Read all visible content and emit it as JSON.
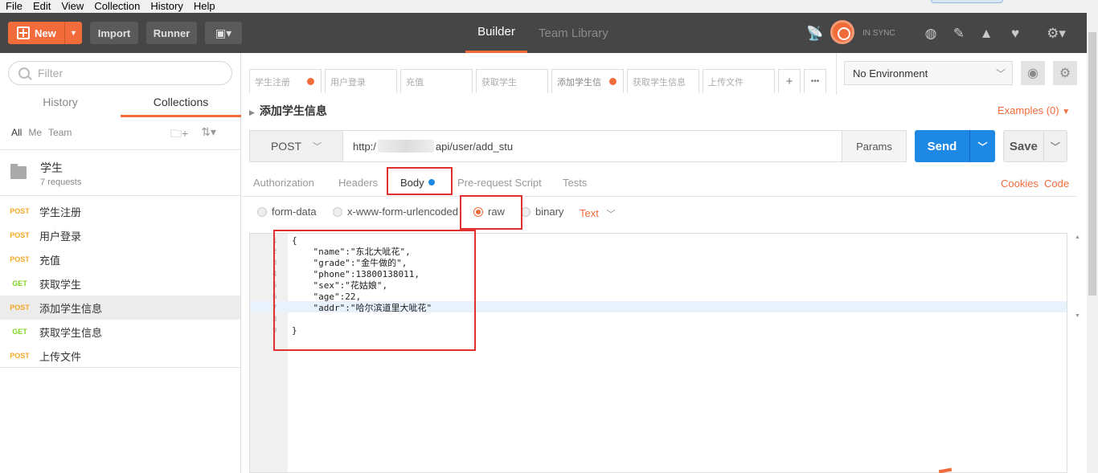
{
  "menu": [
    "File",
    "Edit",
    "View",
    "Collection",
    "History",
    "Help"
  ],
  "toolbar": {
    "new_label": "New",
    "import_label": "Import",
    "runner_label": "Runner",
    "builder_tab": "Builder",
    "team_library_tab": "Team Library",
    "sync_status": "IN SYNC"
  },
  "sidebar": {
    "filter_placeholder": "Filter",
    "tabs": [
      "History",
      "Collections"
    ],
    "active_tab": "Collections",
    "filters": [
      "All",
      "Me",
      "Team"
    ],
    "collection": {
      "name": "学生",
      "count": "7 requests"
    },
    "requests": [
      {
        "method": "POST",
        "name": "学生注册"
      },
      {
        "method": "POST",
        "name": "用户登录"
      },
      {
        "method": "POST",
        "name": "充值"
      },
      {
        "method": "GET",
        "name": "获取学生"
      },
      {
        "method": "POST",
        "name": "添加学生信息"
      },
      {
        "method": "GET",
        "name": "获取学生信息"
      },
      {
        "method": "POST",
        "name": "上传文件"
      }
    ]
  },
  "request_tabs": [
    {
      "label": "学生注册",
      "unsaved": true
    },
    {
      "label": "用户登录",
      "unsaved": false
    },
    {
      "label": "充值",
      "unsaved": false
    },
    {
      "label": "获取学生",
      "unsaved": false
    },
    {
      "label": "添加学生信",
      "unsaved": true
    },
    {
      "label": "获取学生信息",
      "unsaved": false
    },
    {
      "label": "上传文件",
      "unsaved": false
    }
  ],
  "tab_add": "+",
  "tab_more": "•••",
  "environment": {
    "selected": "No Environment"
  },
  "request": {
    "title": "添加学生信息",
    "examples": "Examples (0)",
    "method": "POST",
    "url_prefix": "http:/",
    "url_suffix": "api/user/add_stu",
    "params_label": "Params",
    "send_label": "Send",
    "save_label": "Save"
  },
  "subtabs": [
    "Authorization",
    "Headers",
    "Body",
    "Pre-request Script",
    "Tests"
  ],
  "active_subtab": "Body",
  "right_links": {
    "cookies": "Cookies",
    "code": "Code"
  },
  "body_modes": [
    "form-data",
    "x-www-form-urlencoded",
    "raw",
    "binary"
  ],
  "selected_body_mode": "raw",
  "raw_type": "Text",
  "editor": {
    "line_numbers": [
      "1",
      "2",
      "3",
      "4",
      "5",
      "6",
      "7",
      "8",
      "9"
    ],
    "lines": [
      "{",
      "    \"name\":\"东北大呲花\",",
      "    \"grade\":\"金牛做的\",",
      "    \"phone\":13800138011,",
      "    \"sex\":\"花姑娘\",",
      "    \"age\":22,",
      "    \"addr\":\"哈尔滨道里大呲花\"",
      "",
      "}"
    ]
  },
  "colors": {
    "accent": "#f26b3a",
    "send_blue": "#1e88e5",
    "toolbar_bg": "#464646",
    "highlight_red": "#e0302f"
  }
}
